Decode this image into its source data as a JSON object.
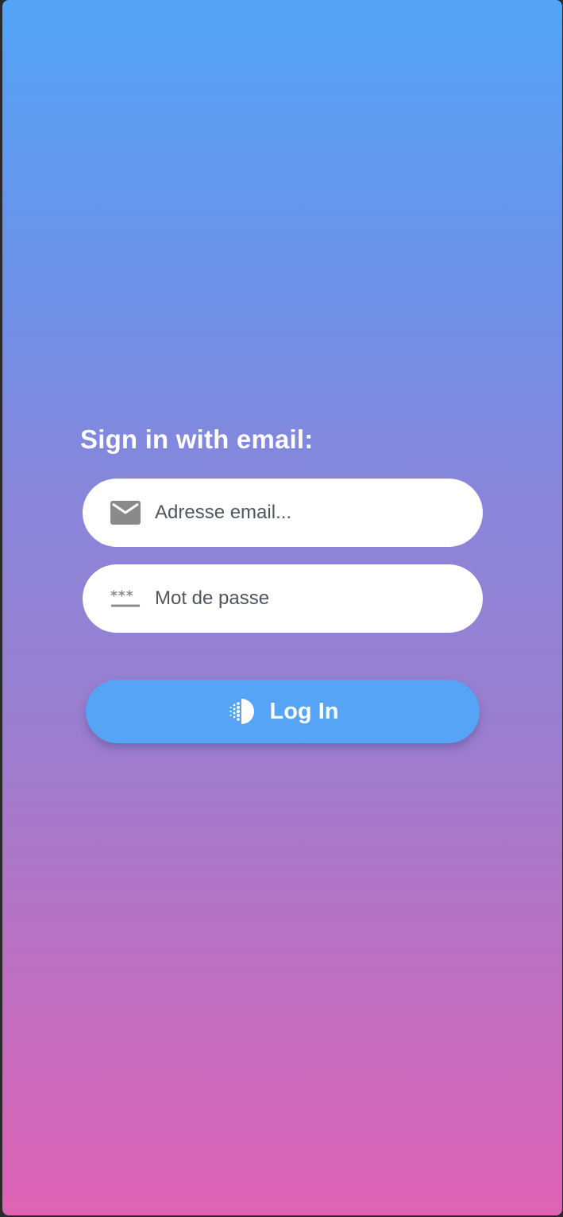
{
  "login": {
    "heading": "Sign in with email:",
    "email": {
      "icon": "email-icon",
      "value": "",
      "placeholder": "Adresse email..."
    },
    "password": {
      "icon": "password-icon",
      "value": "",
      "placeholder": "Mot de passe"
    },
    "button": {
      "icon": "halftone-circle-icon",
      "label": "Log In"
    }
  },
  "colors": {
    "gradient_top": "#53a4f6",
    "gradient_bottom": "#df63b5",
    "button": "#55a4f6",
    "field_background": "#ffffff",
    "icon_gray": "#8a8a8a"
  }
}
